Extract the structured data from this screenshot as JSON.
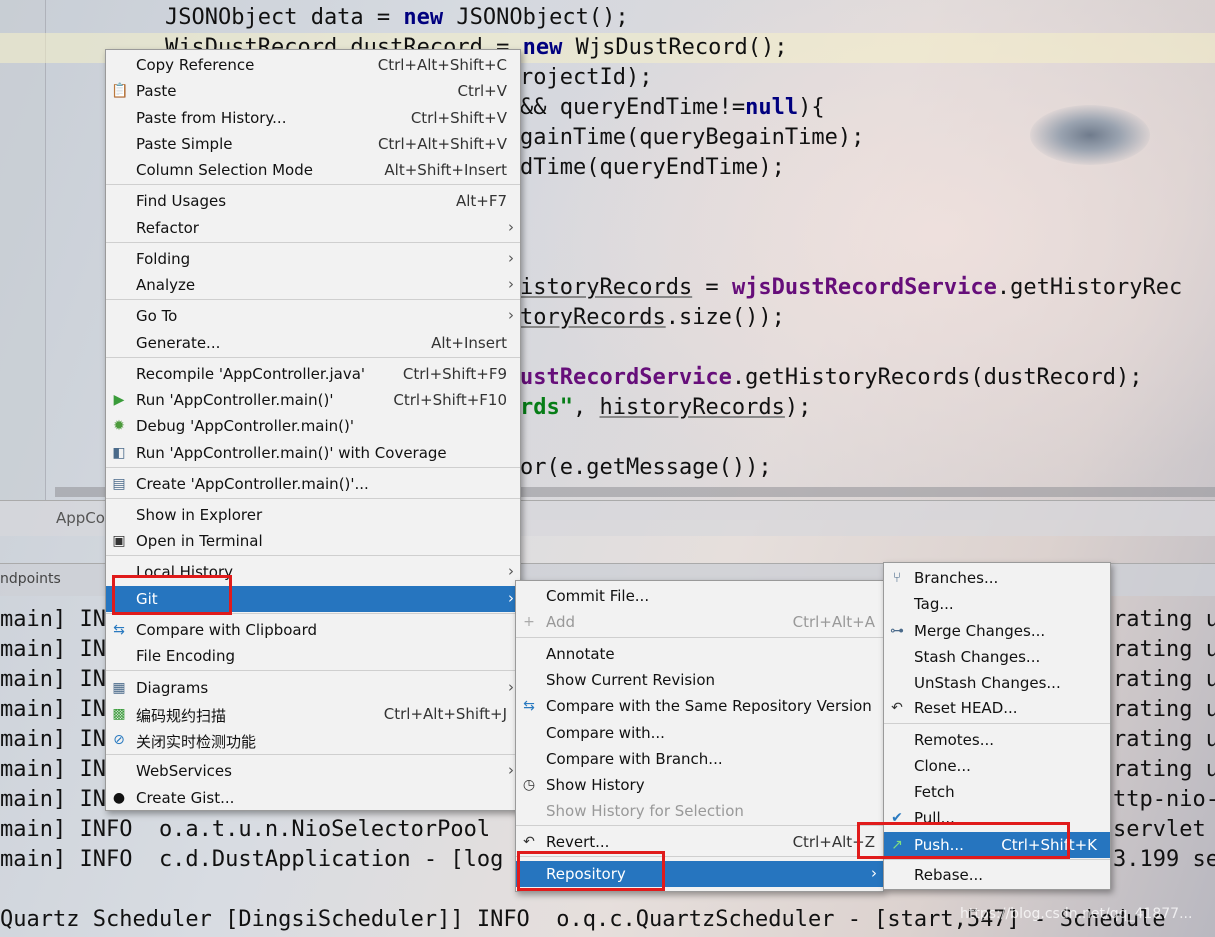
{
  "editor": {
    "lines": [
      {
        "pre": "JSONObject data = ",
        "kw": "new",
        "post": " JSONObject();"
      },
      {
        "pre": "WjsDustRecord dustRecord = ",
        "kw": "new",
        "post": " WjsDustRecord();"
      },
      {
        "text": "rojectId);"
      },
      {
        "pre": "&& queryEndTime!=",
        "kw": "null",
        "post": "){"
      },
      {
        "text": "gainTime(queryBegainTime);"
      },
      {
        "text": "dTime(queryEndTime);"
      },
      {
        "a": "istoryRecords",
        "b": " = ",
        "c": "wjsDustRecordService",
        "d": ".getHistoryRec"
      },
      {
        "a": "toryRecords",
        "b": ".size());"
      },
      {
        "a": "ustRecordService",
        "b": ".getHistoryRecords(dustRecord);"
      },
      {
        "a": "rds\"",
        "b": ", ",
        "c": "historyRecords",
        "d": ");"
      },
      {
        "text": "or(e.getMessage());"
      }
    ],
    "tab_label": "AppCo"
  },
  "console": {
    "toolbar_label": "ndpoints",
    "lines": [
      {
        "left": "main] IN",
        "right": "rating u"
      },
      {
        "left": "main] IN",
        "right": "rating u"
      },
      {
        "left": "main] IN",
        "right": "rating u"
      },
      {
        "left": "main] IN",
        "right": "rating u"
      },
      {
        "left": "main] IN",
        "right": "rating u"
      },
      {
        "left": "main] IN",
        "right": "rating u"
      },
      {
        "left": "main] IN",
        "right": "ttp-nio-"
      },
      {
        "left": "main] INFO  o.a.t.u.n.NioSelectorPool",
        "right": "servlet"
      },
      {
        "left": "main] INFO  c.d.DustApplication - [log",
        "right": "3.199 se"
      }
    ],
    "bottom_line": "Quartz Scheduler [DingsiScheduler]] INFO  o.q.c.QuartzScheduler - [start,547] - Schedule",
    "watermark": "https://blog.csdn.net/qq_41877..."
  },
  "context_menu": {
    "items": [
      {
        "label": "Copy Reference",
        "shortcut": "Ctrl+Alt+Shift+C"
      },
      {
        "label": "Paste",
        "shortcut": "Ctrl+V",
        "icon": "clipboard-icon"
      },
      {
        "label": "Paste from History...",
        "shortcut": "Ctrl+Shift+V"
      },
      {
        "label": "Paste Simple",
        "shortcut": "Ctrl+Alt+Shift+V"
      },
      {
        "label": "Column Selection Mode",
        "shortcut": "Alt+Shift+Insert"
      },
      {
        "label": "Find Usages",
        "shortcut": "Alt+F7"
      },
      {
        "label": "Refactor",
        "submenu": true
      },
      {
        "label": "Folding",
        "submenu": true
      },
      {
        "label": "Analyze",
        "submenu": true
      },
      {
        "label": "Go To",
        "submenu": true
      },
      {
        "label": "Generate...",
        "shortcut": "Alt+Insert"
      },
      {
        "label": "Recompile 'AppController.java'",
        "shortcut": "Ctrl+Shift+F9"
      },
      {
        "label": "Run 'AppController.main()'",
        "shortcut": "Ctrl+Shift+F10",
        "icon": "run-icon"
      },
      {
        "label": "Debug 'AppController.main()'",
        "icon": "debug-icon"
      },
      {
        "label": "Run 'AppController.main()' with Coverage",
        "icon": "coverage-icon"
      },
      {
        "label": "Create 'AppController.main()'...",
        "icon": "run-config-icon"
      },
      {
        "label": "Show in Explorer"
      },
      {
        "label": "Open in Terminal",
        "icon": "terminal-icon"
      },
      {
        "label": "Local History",
        "submenu": true
      },
      {
        "label": "Git",
        "submenu": true,
        "selected": true
      },
      {
        "label": "Compare with Clipboard",
        "icon": "compare-icon"
      },
      {
        "label": "File Encoding"
      },
      {
        "label": "Diagrams",
        "submenu": true,
        "icon": "diagram-icon"
      },
      {
        "label": "编码规约扫描",
        "shortcut": "Ctrl+Alt+Shift+J",
        "icon": "scan-icon"
      },
      {
        "label": "关闭实时检测功能",
        "icon": "disable-icon"
      },
      {
        "label": "WebServices",
        "submenu": true
      },
      {
        "label": "Create Gist...",
        "icon": "github-icon"
      }
    ]
  },
  "git_menu": {
    "items": [
      {
        "label": "Commit File..."
      },
      {
        "label": "Add",
        "shortcut": "Ctrl+Alt+A",
        "disabled": true,
        "icon": "plus-icon"
      },
      {
        "label": "Annotate"
      },
      {
        "label": "Show Current Revision"
      },
      {
        "label": "Compare with the Same Repository Version",
        "icon": "compare-icon"
      },
      {
        "label": "Compare with..."
      },
      {
        "label": "Compare with Branch..."
      },
      {
        "label": "Show History",
        "icon": "history-icon"
      },
      {
        "label": "Show History for Selection",
        "disabled": true
      },
      {
        "label": "Revert...",
        "shortcut": "Ctrl+Alt+Z",
        "icon": "revert-icon"
      },
      {
        "label": "Repository",
        "submenu": true,
        "selected": true
      }
    ]
  },
  "repo_menu": {
    "items": [
      {
        "label": "Branches...",
        "icon": "branch-icon"
      },
      {
        "label": "Tag..."
      },
      {
        "label": "Merge Changes...",
        "icon": "merge-icon"
      },
      {
        "label": "Stash Changes..."
      },
      {
        "label": "UnStash Changes..."
      },
      {
        "label": "Reset HEAD...",
        "icon": "reset-icon"
      },
      {
        "label": "Remotes..."
      },
      {
        "label": "Clone..."
      },
      {
        "label": "Fetch"
      },
      {
        "label": "Pull...",
        "icon": "pull-icon"
      },
      {
        "label": "Push...",
        "shortcut": "Ctrl+Shift+K",
        "selected": true,
        "icon": "push-icon"
      },
      {
        "label": "Rebase..."
      }
    ]
  },
  "colors": {
    "selection": "#2675bf",
    "highlight_box": "#e01b1b",
    "keyword": "#00007f",
    "field": "#660e7a",
    "string": "#067d17"
  }
}
